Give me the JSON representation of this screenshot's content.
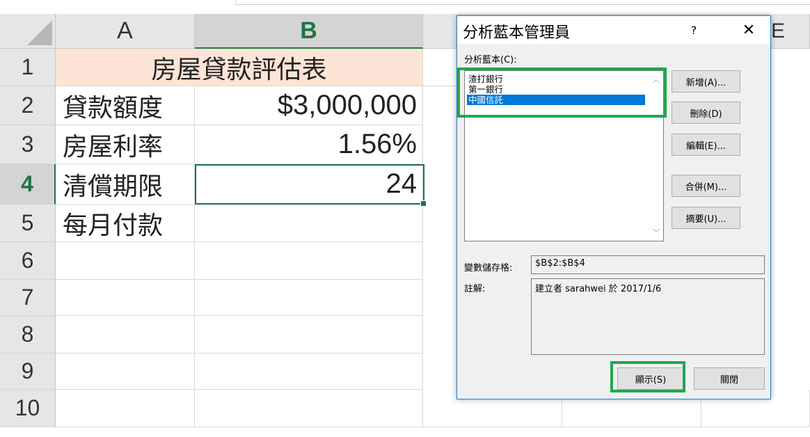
{
  "columns": [
    "A",
    "B",
    "",
    "",
    ""
  ],
  "rows": [
    "1",
    "2",
    "3",
    "4",
    "5",
    "6",
    "7",
    "8",
    "9",
    "10"
  ],
  "col_e_partial": "E",
  "sheet": {
    "title": "房屋貸款評估表",
    "r2": {
      "label": "貸款額度",
      "value": "$3,000,000"
    },
    "r3": {
      "label": "房屋利率",
      "value": "1.56%"
    },
    "r4": {
      "label": "清償期限",
      "value": "24"
    },
    "r5": {
      "label": "每月付款",
      "value": ""
    }
  },
  "dialog": {
    "title": "分析藍本管理員",
    "help": "?",
    "close": "✕",
    "scenarios_label": "分析藍本(C):",
    "scenarios": [
      "渣打銀行",
      "第一銀行",
      "中國信託"
    ],
    "selected_index": 2,
    "buttons": {
      "add": "新增(A)...",
      "delete": "刪除(D)",
      "edit": "編輯(E)...",
      "merge": "合併(M)...",
      "summary": "摘要(U)...",
      "show": "顯示(S)",
      "close": "關閉"
    },
    "changing_cells_label": "變數儲存格:",
    "changing_cells_value": "$B$2:$B$4",
    "comment_label": "註解:",
    "comment_value": "建立者 sarahwei 於 2017/1/6"
  },
  "colors": {
    "accent_green": "#217346",
    "highlight_green": "#1fa84f",
    "title_fill": "#fce4d6",
    "selection_blue": "#0078d7"
  }
}
